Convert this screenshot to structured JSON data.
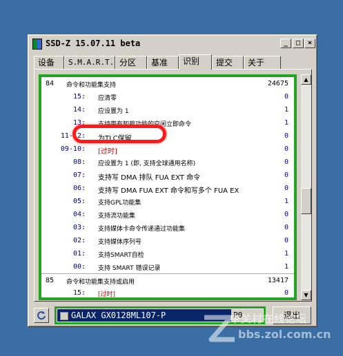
{
  "window": {
    "title": "SSD-Z 15.07.11 beta",
    "controls": {
      "minimize": "_",
      "maximize": "□",
      "close": "×"
    }
  },
  "tabs": [
    {
      "label": "设备",
      "active": false
    },
    {
      "label": "S.M.A.R.T.",
      "active": false
    },
    {
      "label": "分区",
      "active": false
    },
    {
      "label": "基准",
      "active": false
    },
    {
      "label": "识别",
      "active": true
    },
    {
      "label": "提交",
      "active": false
    },
    {
      "label": "关于",
      "active": false
    }
  ],
  "features": [
    {
      "type": "header",
      "id": "84",
      "desc": "命令和功能集支持",
      "value": "24675"
    },
    {
      "type": "bit",
      "sub": "15:",
      "desc": "应清零",
      "value": "0"
    },
    {
      "type": "bit",
      "sub": "14:",
      "desc": "应设置为 1",
      "value": "1"
    },
    {
      "type": "bit",
      "sub": "13:",
      "desc": "支持带有卸载功能的空闲立即命令",
      "value": "1"
    },
    {
      "type": "bit",
      "sub": "11-12:",
      "desc": "为TLC保留",
      "value": "0",
      "sub_red": false,
      "desc_red": false,
      "big": true
    },
    {
      "type": "bit",
      "sub": "09-10:",
      "desc": "[过时]",
      "value": "0",
      "desc_red": true,
      "big": true
    },
    {
      "type": "bit",
      "sub": "08:",
      "desc": "应设置为 1 (即, 支持全球通用名称)",
      "value": "0"
    },
    {
      "type": "bit",
      "sub": "07:",
      "desc": "支持写 DMA 排队 FUA EXT 命令",
      "value": "0",
      "big": true
    },
    {
      "type": "bit",
      "sub": "06:",
      "desc": "支持写 DMA FUA EXT 命令和写多个 FUA EX",
      "value": "0",
      "big": true
    },
    {
      "type": "bit",
      "sub": "05:",
      "desc": "支持GPL功能集",
      "value": "1"
    },
    {
      "type": "bit",
      "sub": "04:",
      "desc": "支持流功能集",
      "value": "0"
    },
    {
      "type": "bit",
      "sub": "03:",
      "desc": "支持媒体卡命令传递通过功能集",
      "value": "0"
    },
    {
      "type": "bit",
      "sub": "02:",
      "desc": "支持媒体序列号",
      "value": "0"
    },
    {
      "type": "bit",
      "sub": "01:",
      "desc": "支持SMART自检",
      "value": "1"
    },
    {
      "type": "bit",
      "sub": "00:",
      "desc": "支持 SMART 错误记录",
      "value": "1"
    },
    {
      "type": "header",
      "id": "85",
      "desc": "命令和功能集支持或启用",
      "value": "13417",
      "sep": true
    },
    {
      "type": "bit",
      "sub": "15:",
      "desc": "[过时]",
      "value": "0",
      "desc_red": true
    }
  ],
  "drive": {
    "name": "GALAX GX0128ML107-P",
    "right": "P0"
  },
  "exit_label": "退出",
  "watermark": {
    "text": "中关村在线论坛",
    "url": "bbs.zol.com.cn"
  },
  "colors": {
    "desktop": "#3a6ea5",
    "border_green": "#22a322",
    "highlight": "#ff1a1a"
  }
}
